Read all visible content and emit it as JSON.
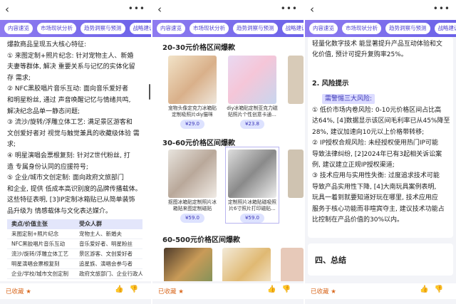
{
  "tabs": [
    "内容速览",
    "市场现状分析",
    "趋势洞察与预测",
    "战略建议"
  ],
  "footer": {
    "fav_label": "已收藏 ★"
  },
  "panel1": {
    "lines": [
      "爆款商品呈现五大核心特征:",
      "① 来图定制+照片纪念: 针对宠物主人、新婚",
      "夫妻等群体, 解决 重要关系与记忆的实体化留",
      "存 需求;",
      "② NFC黑胶唱片音乐互动: 面向音乐爱好者",
      "和明星粉丝, 通过 声音唤醒记忆与情绪共鸣,",
      "解决纪念品单一静态问题;",
      "③ 流沙/旋转/浮雕立体工艺: 满足景区游客和",
      "文创爱好者对 视觉与触觉兼具的收藏级体验 需求;",
      "④ 明星演唱会票根复刻: 针对Z世代粉丝, 打",
      "造 专属身份认同的应援符号;",
      "⑤ 企业/城市文创定制: 面向政府文旅部门",
      "和企业, 提供 低成本高识别度的品牌传播载体。",
      "这些特征表明, [3]IP定制冰箱贴已从简单装饰",
      "品升级为 情感载体与文化表达媒介。"
    ],
    "table": {
      "headers": [
        "卖点/价值主张",
        "受众人群"
      ],
      "rows": [
        [
          "来图定制+照片纪念",
          "宠物主人、新婚夫"
        ],
        [
          "NFC黑胶唱片音乐互动",
          "音乐爱好者、明星粉丝"
        ],
        [
          "流沙/旋转/浮雕立体工艺",
          "景区游客、文创爱好者"
        ],
        [
          "明星演唱会票根复刻",
          "追星族、演唱会参与者"
        ],
        [
          "企业/学校/城市文创定制",
          "政府文旅部门、企业行政人"
        ]
      ]
    }
  },
  "panel2": {
    "section1": "20-30元价格区间爆款",
    "products1": [
      {
        "title": "宠物头像定克力冰箱贴定制吸照片diy猫咪",
        "price": "¥29.0"
      },
      {
        "title": "diy冰箱贴定制亚克力磁贴照片个性创意卡通…",
        "price": "¥23.8"
      }
    ],
    "section2": "30-60元价格区间爆款",
    "products2": [
      {
        "title": "抠图冰箱贴定制照片冰箱贴来图定制磁贴",
        "price": "¥59.0"
      },
      {
        "title": "定制照片冰箱贴磁吸照片6寸照片打印磁贴…",
        "price": "¥59.0"
      }
    ],
    "section3": "60-500元价格区间爆款"
  },
  "panel3": {
    "top_lines": [
      "轻量化数字技术 能显著提升产品互动体验和文",
      "化价值, 预计可提升复购率25%。"
    ],
    "heading2": "2. 风险提示",
    "badge": "需警惕三大风险:",
    "lines": [
      "① 低价市场内卷风险: 0-10元价格区间占比高",
      "达64%, [4]数据显示该区间毛利率已从45%降至",
      "28%, 建议加速向10元以上价格带转移;",
      "② IP授权合规风险: 未经授权使用热门IP可能",
      "导致法律纠纷, [2]2024年已有3起相关诉讼案",
      "例, 建议建立正规IP授权渠道;",
      "③ 技术应用与实用性失衡: 过度追求技术可能",
      "导致产品实用性下降, [4]大南玩具案例表明,",
      "玩具一着到就要知道好玩在哪里, 技术应用应",
      "服务于核心功能而非喧宾夺主, 建议技术功能占",
      "比控制在产品价值的30%以内。"
    ],
    "section4": "四、总结"
  }
}
